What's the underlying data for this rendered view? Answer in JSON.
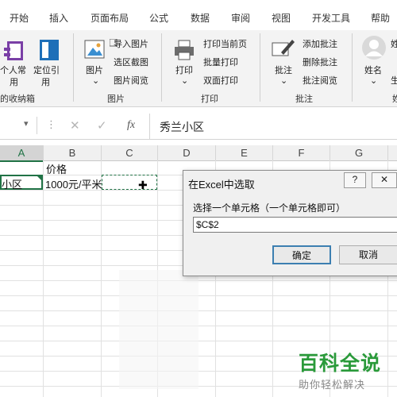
{
  "ribbon_tabs": [
    "开始",
    "插入",
    "页面布局",
    "公式",
    "数据",
    "审阅",
    "视图",
    "开发工具",
    "帮助"
  ],
  "ribbon": {
    "group1": {
      "btn_personal": "个人常",
      "btn_personal2": "用",
      "btn_locate": "定位引",
      "btn_locate2": "用",
      "label": "的收纳箱"
    },
    "group_pic": {
      "btn_picture": "图片",
      "import": "导入图片",
      "region": "选区截图",
      "browse": "图片阅览",
      "label": "图片"
    },
    "group_print": {
      "btn_print": "打印",
      "current": "打印当前页",
      "batch": "批量打印",
      "duplex": "双面打印",
      "label": "打印"
    },
    "group_comment": {
      "btn_comment": "批注",
      "add": "添加批注",
      "delete": "删除批注",
      "browse": "批注阅览",
      "label": "批注"
    },
    "group_name": {
      "btn_name": "姓名",
      "c1": "姓",
      "c2": "生",
      "label": "姓"
    }
  },
  "formula_bar": {
    "value": "秀兰小区",
    "fx": "fx"
  },
  "columns": [
    "A",
    "B",
    "C",
    "D",
    "E",
    "F",
    "G"
  ],
  "cells": {
    "a1": "",
    "b1": "价格",
    "a2": "小区",
    "b2": "1000元/平米"
  },
  "dialog": {
    "title": "在Excel中选取",
    "help": "?",
    "close": "✕",
    "prompt": "选择一个单元格（一个单元格即可）",
    "input_value": "$C$2",
    "ok": "确定",
    "cancel": "取消"
  },
  "watermark": {
    "main": "百科全说",
    "sub": "助你轻松解决"
  }
}
